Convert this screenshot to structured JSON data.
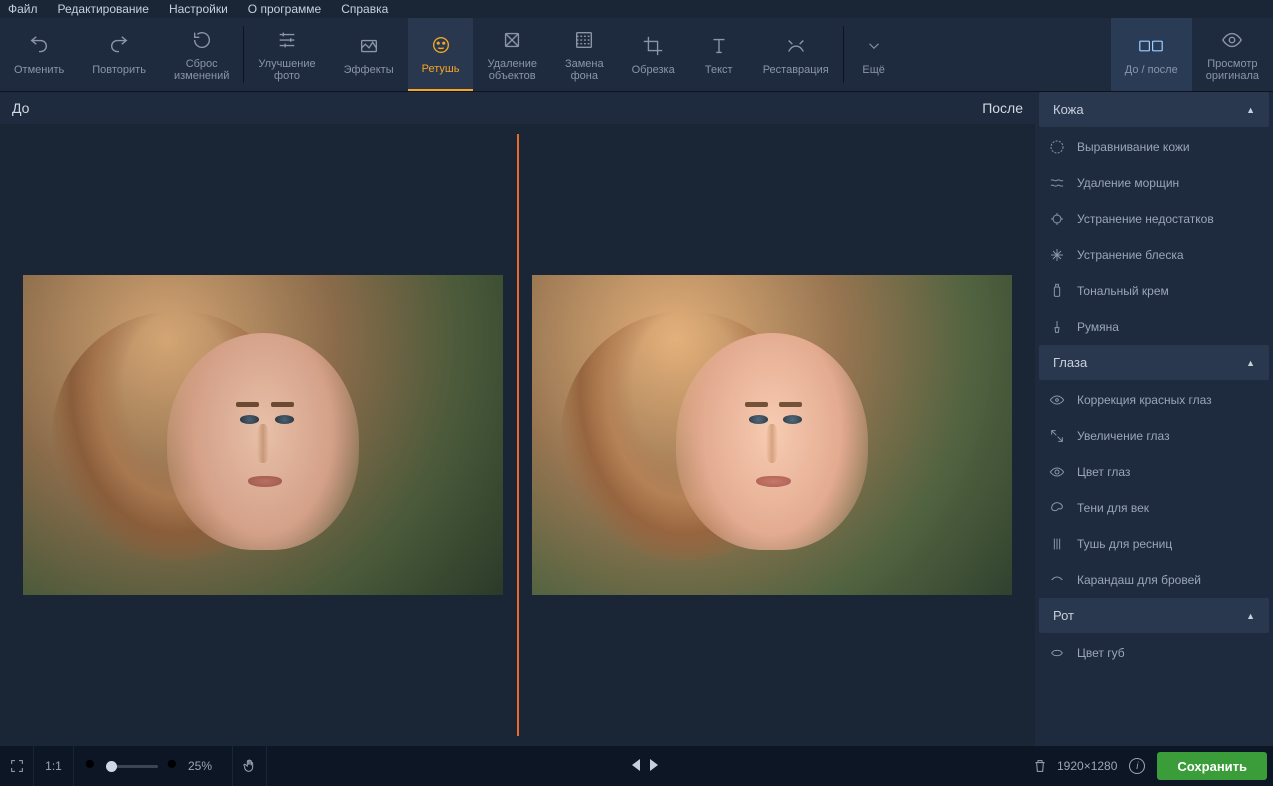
{
  "menu": {
    "file": "Файл",
    "edit": "Редактирование",
    "settings": "Настройки",
    "about": "О программе",
    "help": "Справка"
  },
  "toolbar": {
    "undo": "Отменить",
    "redo": "Повторить",
    "reset": "Сброс\nизменений",
    "enhance": "Улучшение\nфото",
    "effects": "Эффекты",
    "retouch": "Ретушь",
    "remove": "Удаление\nобъектов",
    "bg": "Замена\nфона",
    "crop": "Обрезка",
    "text": "Текст",
    "restore": "Реставрация",
    "more": "Ещё",
    "before_after": "До / после",
    "original": "Просмотр\nоригинала"
  },
  "workspace": {
    "before": "До",
    "after": "После"
  },
  "sidebar": {
    "skin": {
      "title": "Кожа",
      "items": [
        "Выравнивание кожи",
        "Удаление морщин",
        "Устранение недостатков",
        "Устранение блеска",
        "Тональный крем",
        "Румяна"
      ]
    },
    "eyes": {
      "title": "Глаза",
      "items": [
        "Коррекция красных глаз",
        "Увеличение глаз",
        "Цвет глаз",
        "Тени для век",
        "Тушь для ресниц",
        "Карандаш для бровей"
      ]
    },
    "mouth": {
      "title": "Рот",
      "items": [
        "Цвет губ"
      ]
    }
  },
  "footer": {
    "ratio": "1:1",
    "zoom": "25%",
    "dims": "1920×1280",
    "save": "Сохранить"
  }
}
